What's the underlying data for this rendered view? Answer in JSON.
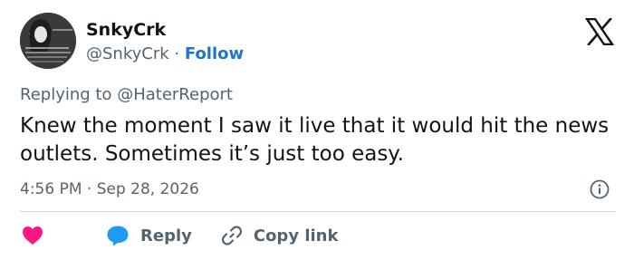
{
  "user": {
    "display_name": "SnkyCrk",
    "handle": "@SnkyCrk",
    "separator": "·",
    "follow_label": "Follow"
  },
  "reply_to": {
    "prefix": "Replying to ",
    "handle": "@HaterReport"
  },
  "tweet": {
    "text": "Knew the moment I saw it live that it would hit the news outlets. Sometimes it’s just too easy."
  },
  "meta": {
    "time": "4:56 PM",
    "separator": "·",
    "date": "Sep 28, 2026"
  },
  "actions": {
    "reply_label": "Reply",
    "copy_link_label": "Copy link"
  },
  "colors": {
    "follow": "#1d74d0",
    "heart": "#f91880",
    "reply_bubble": "#1d9bf0",
    "secondary_text": "#536471"
  },
  "icons": {
    "logo": "x-logo-icon",
    "info": "info-icon",
    "like": "heart-icon",
    "reply": "chat-bubble-icon",
    "copy": "link-icon"
  }
}
